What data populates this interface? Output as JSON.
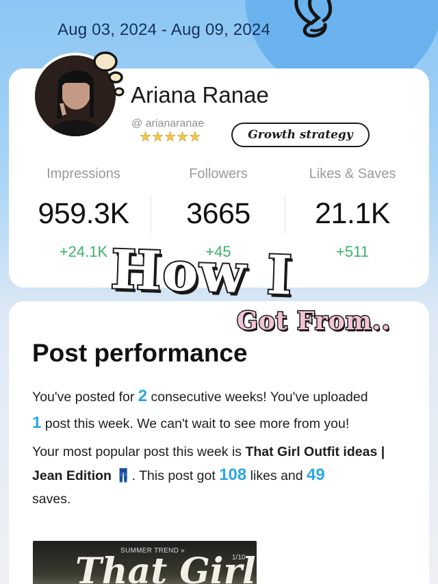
{
  "header": {
    "date_range": "Aug 03, 2024 - Aug 09, 2024"
  },
  "profile": {
    "name": "Ariana Ranae",
    "handle": "@ arianaranae",
    "rating_stars": 5,
    "strategy_button": "Growth strategy"
  },
  "stats": [
    {
      "label": "Impressions",
      "value": "959.3K",
      "delta": "+24.1K"
    },
    {
      "label": "Followers",
      "value": "3665",
      "delta": "+45"
    },
    {
      "label": "Likes & Saves",
      "value": "21.1K",
      "delta": "+511"
    }
  ],
  "overlay": {
    "how": "How I",
    "got": "Got From.."
  },
  "performance": {
    "title": "Post performance",
    "p1_a": "You've posted for ",
    "weeks": "2",
    "p1_b": " consecutive weeks! You've uploaded ",
    "posts": "1",
    "p1_c": " post this week. We can't wait to see more from you!",
    "p2_a": "Your most popular post this week is ",
    "post_title": "That Girl Outfit ideas | Jean Edition",
    "jeans_emoji": "👖",
    "p2_b": ". This post got ",
    "likes": "108",
    "p2_c": " likes and ",
    "saves": "49",
    "p2_d": " saves."
  },
  "thumbnail": {
    "trend": "SUMMER TREND »",
    "count": "1/10",
    "title": "That Girl"
  },
  "colors": {
    "accent_blue": "#2aa7e6",
    "positive_green": "#3bb068",
    "sky": "#8cc6f4"
  }
}
